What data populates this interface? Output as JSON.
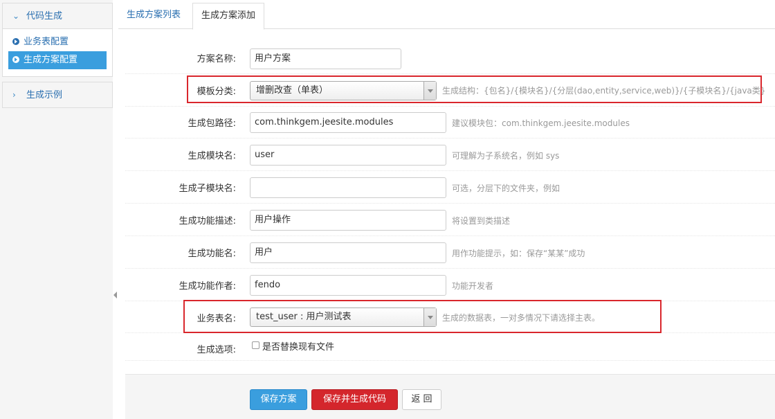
{
  "sidebar": {
    "panel1_title": "代码生成",
    "items": [
      {
        "label": "业务表配置"
      },
      {
        "label": "生成方案配置"
      }
    ],
    "panel2_title": "生成示例"
  },
  "tabs": [
    {
      "label": "生成方案列表"
    },
    {
      "label": "生成方案添加"
    }
  ],
  "form": {
    "name": {
      "label": "方案名称:",
      "value": "用户方案"
    },
    "category": {
      "label": "模板分类:",
      "value": "增删改查（单表）",
      "help": "生成结构：{包名}/{模块名}/{分层(dao,entity,service,web)}/{子模块名}/{java类}"
    },
    "package": {
      "label": "生成包路径:",
      "value": "com.thinkgem.jeesite.modules",
      "help": "建议模块包：com.thinkgem.jeesite.modules"
    },
    "module": {
      "label": "生成模块名:",
      "value": "user",
      "help": "可理解为子系统名，例如 sys"
    },
    "submodule": {
      "label": "生成子模块名:",
      "value": "",
      "help": "可选，分层下的文件夹，例如"
    },
    "func_desc": {
      "label": "生成功能描述:",
      "value": "用户操作",
      "help": "将设置到类描述"
    },
    "func_name": {
      "label": "生成功能名:",
      "value": "用户",
      "help": "用作功能提示，如：保存“某某”成功"
    },
    "author": {
      "label": "生成功能作者:",
      "value": "fendo",
      "help": "功能开发者"
    },
    "table": {
      "label": "业务表名:",
      "value": "test_user : 用户测试表",
      "help": "生成的数据表，一对多情况下请选择主表。"
    },
    "options": {
      "label": "生成选项:",
      "checkbox_label": "是否替换现有文件"
    }
  },
  "buttons": {
    "save": "保存方案",
    "save_generate": "保存并生成代码",
    "back": "返 回"
  },
  "colors": {
    "accent": "#3a9ede",
    "danger": "#d4262c",
    "highlight_box": "#d9262c"
  }
}
